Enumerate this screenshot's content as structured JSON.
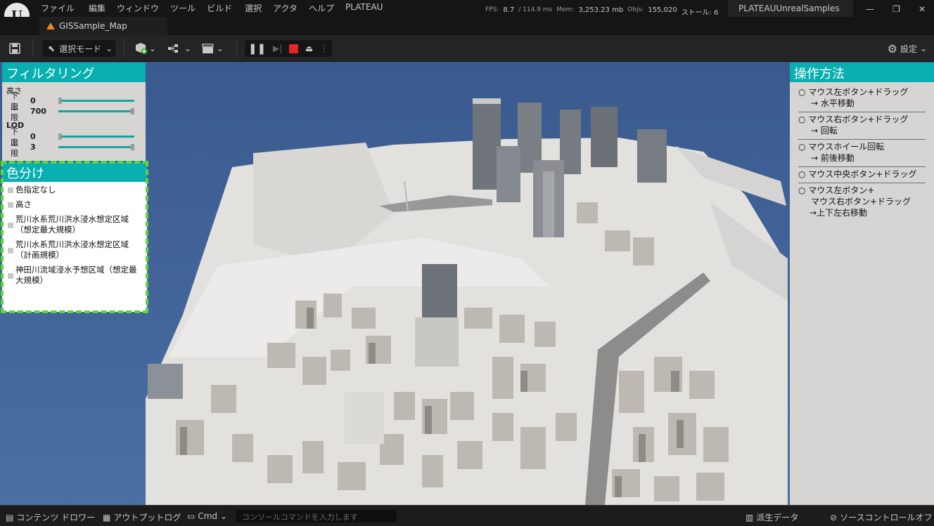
{
  "menu": [
    "ファイル",
    "編集",
    "ウィンドウ",
    "ツール",
    "ビルド",
    "選択",
    "アクタ",
    "ヘルプ",
    "PLATEAU"
  ],
  "stats": {
    "fps_label": "FPS:",
    "fps": "8.7",
    "ms": "/ 114.9 ms",
    "mem_label": "Mem:",
    "mem": "3,253.23 mb",
    "objs_label": "Objs:",
    "objs": "155,020",
    "stall": "ストール: 6"
  },
  "project_name": "PLATEAUUnrealSamples",
  "document_tab": "GISSample_Map",
  "toolbar": {
    "mode_label": "選択モード",
    "settings_label": "設定"
  },
  "filter_panel": {
    "title": "フィルタリング",
    "height": {
      "label": "高さ",
      "min_label": "下限",
      "min_value": "0",
      "max_label": "上限",
      "max_value": "700"
    },
    "lod": {
      "label": "LOD",
      "min_label": "下限",
      "min_value": "0",
      "max_label": "上限",
      "max_value": "3"
    }
  },
  "color_panel": {
    "title": "色分け",
    "items": [
      "色指定なし",
      "高さ",
      "荒川水系荒川洪水浸水想定区域（想定最大規模）",
      "荒川水系荒川洪水浸水想定区域（計画規模）",
      "神田川流域浸水予想区域（想定最大規模）"
    ]
  },
  "ops_panel": {
    "title": "操作方法",
    "items": [
      {
        "line1": "○ マウス左ボタン+ドラッグ",
        "line2": "→ 水平移動"
      },
      {
        "line1": "○ マウス右ボタン+ドラッグ",
        "line2": "→ 回転"
      },
      {
        "line1": "○ マウスホイール回転",
        "line2": "→ 前後移動"
      },
      {
        "line1": "○ マウス中央ボタン+ドラッグ",
        "line2": ""
      },
      {
        "line1": "○ マウス左ボタン+",
        "line2": "マウス右ボタン+ドラッグ",
        "line3": "→上下左右移動"
      }
    ]
  },
  "statusbar": {
    "content_drawer": "コンテンツ ドロワー",
    "output_log": "アウトプットログ",
    "cmd": "Cmd",
    "cmd_placeholder": "コンソールコマンドを入力します",
    "derived_data": "派生データ",
    "source_control": "ソースコントロールオフ"
  },
  "colors": {
    "accent": "#08aeb0",
    "highlight": "#5fd43c",
    "stop": "#e2272b",
    "sky": "#3d5c8f"
  }
}
